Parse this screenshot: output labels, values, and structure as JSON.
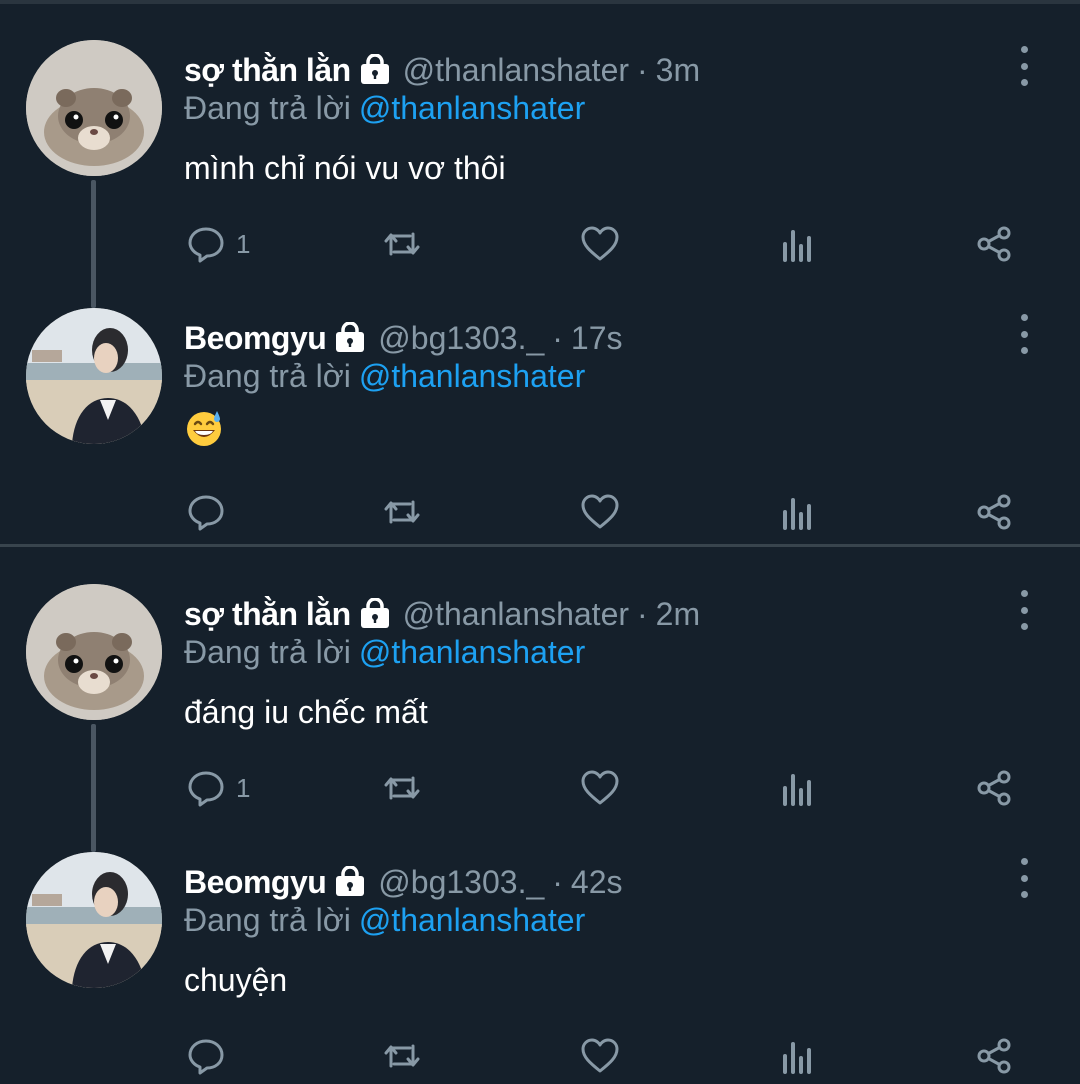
{
  "tweets": [
    {
      "author": "sợ thằn lằn",
      "handle": "@thanlanshater",
      "time": "3m",
      "replying_label": "Đang trả lời",
      "replying_to": "@thanlanshater",
      "text": "mình chỉ nói vu vơ thôi",
      "reply_count": "1",
      "avatar": "hamster-avatar",
      "protected": true
    },
    {
      "author": "Beomgyu",
      "handle": "@bg1303._",
      "time": "17s",
      "replying_label": "Đang trả lời",
      "replying_to": "@thanlanshater",
      "text": "😅",
      "reply_count": "",
      "avatar": "beach-person-avatar",
      "protected": true
    },
    {
      "author": "sợ thằn lằn",
      "handle": "@thanlanshater",
      "time": "2m",
      "replying_label": "Đang trả lời",
      "replying_to": "@thanlanshater",
      "text": "đáng iu chếc mất",
      "reply_count": "1",
      "avatar": "hamster-avatar",
      "protected": true
    },
    {
      "author": "Beomgyu",
      "handle": "@bg1303._",
      "time": "42s",
      "replying_label": "Đang trả lời",
      "replying_to": "@thanlanshater",
      "text": "chuyện",
      "reply_count": "",
      "avatar": "beach-person-avatar",
      "protected": true
    }
  ],
  "separator": "·",
  "colors": {
    "background": "#15202b",
    "secondary_text": "#8899a6",
    "mention": "#1da1f2",
    "divider": "#38444d"
  }
}
